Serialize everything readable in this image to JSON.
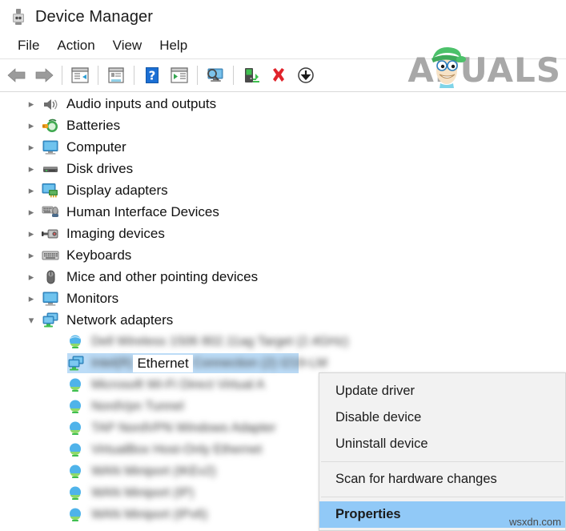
{
  "window": {
    "title": "Device Manager",
    "icon": "device-manager-plug-icon"
  },
  "menubar": {
    "items": [
      {
        "label": "File"
      },
      {
        "label": "Action"
      },
      {
        "label": "View"
      },
      {
        "label": "Help"
      }
    ]
  },
  "toolbar": {
    "buttons": [
      {
        "name": "back-arrow-icon",
        "tooltip": "Back"
      },
      {
        "name": "forward-arrow-icon",
        "tooltip": "Forward"
      },
      {
        "name": "show-hide-console-tree-icon",
        "tooltip": "Show/Hide console tree"
      },
      {
        "name": "properties-icon",
        "tooltip": "Properties"
      },
      {
        "name": "help-icon",
        "tooltip": "Help"
      },
      {
        "name": "show-hide-action-pane-icon",
        "tooltip": "Show/Hide action pane"
      },
      {
        "name": "scan-for-hardware-changes-icon",
        "tooltip": "Scan for hardware changes"
      },
      {
        "name": "update-driver-icon",
        "tooltip": "Update driver"
      },
      {
        "name": "uninstall-device-icon",
        "tooltip": "Uninstall device"
      },
      {
        "name": "disable-device-icon",
        "tooltip": "Disable device"
      }
    ]
  },
  "branding": {
    "logo_text": "PUALS",
    "logo_letter": "A",
    "watermark": "wsxdn.com"
  },
  "tree": {
    "categories": [
      {
        "label": "Audio inputs and outputs",
        "icon": "speaker-icon",
        "expanded": false
      },
      {
        "label": "Batteries",
        "icon": "battery-icon",
        "expanded": false
      },
      {
        "label": "Computer",
        "icon": "monitor-icon",
        "expanded": false
      },
      {
        "label": "Disk drives",
        "icon": "disk-drive-icon",
        "expanded": false
      },
      {
        "label": "Display adapters",
        "icon": "display-adapter-icon",
        "expanded": false
      },
      {
        "label": "Human Interface Devices",
        "icon": "hid-icon",
        "expanded": false
      },
      {
        "label": "Imaging devices",
        "icon": "imaging-device-icon",
        "expanded": false
      },
      {
        "label": "Keyboards",
        "icon": "keyboard-icon",
        "expanded": false
      },
      {
        "label": "Mice and other pointing devices",
        "icon": "mouse-icon",
        "expanded": false
      },
      {
        "label": "Monitors",
        "icon": "monitor-icon",
        "expanded": false
      },
      {
        "label": "Network adapters",
        "icon": "network-adapter-icon",
        "expanded": true
      }
    ],
    "network_children": [
      {
        "label": "Dell Wireless 1506 802.11ag Target (2.4GHz)",
        "redacted": true,
        "selected": false,
        "icon": "wireless-adapter-icon"
      },
      {
        "label": "Ethernet",
        "redacted": false,
        "selected": true,
        "icon": "network-adapter-icon",
        "prefix": "Intel(R)",
        "suffix": "Connection (2) I219-LM"
      },
      {
        "label": "Microsoft Wi-Fi Direct Virtual A",
        "redacted": true,
        "selected": false,
        "icon": "wireless-adapter-icon"
      },
      {
        "label": "NordVpn Tunnel",
        "redacted": true,
        "selected": false,
        "icon": "wireless-adapter-icon"
      },
      {
        "label": "TAP NordVPN Windows Adapter",
        "redacted": true,
        "selected": false,
        "icon": "wireless-adapter-icon"
      },
      {
        "label": "VirtualBox Host-Only Ethernet",
        "redacted": true,
        "selected": false,
        "icon": "wireless-adapter-icon"
      },
      {
        "label": "WAN Miniport (IKEv2)",
        "redacted": true,
        "selected": false,
        "icon": "wireless-adapter-icon"
      },
      {
        "label": "WAN Miniport (IP)",
        "redacted": true,
        "selected": false,
        "icon": "wireless-adapter-icon"
      },
      {
        "label": "WAN Miniport (IPv6)",
        "redacted": true,
        "selected": false,
        "icon": "wireless-adapter-icon"
      }
    ]
  },
  "context_menu": {
    "items": [
      {
        "label": "Update driver",
        "selected": false,
        "separator_after": false
      },
      {
        "label": "Disable device",
        "selected": false,
        "separator_after": false
      },
      {
        "label": "Uninstall device",
        "selected": false,
        "separator_after": true
      },
      {
        "label": "Scan for hardware changes",
        "selected": false,
        "separator_after": true
      },
      {
        "label": "Properties",
        "selected": true,
        "separator_after": false
      }
    ]
  },
  "colors": {
    "selection_blue": "#91c9f7",
    "row_selection": "#bcdcf7",
    "menu_bg": "#f2f2f2",
    "logo_gray": "#9a9a9a",
    "cap_green": "#4cc16a"
  }
}
